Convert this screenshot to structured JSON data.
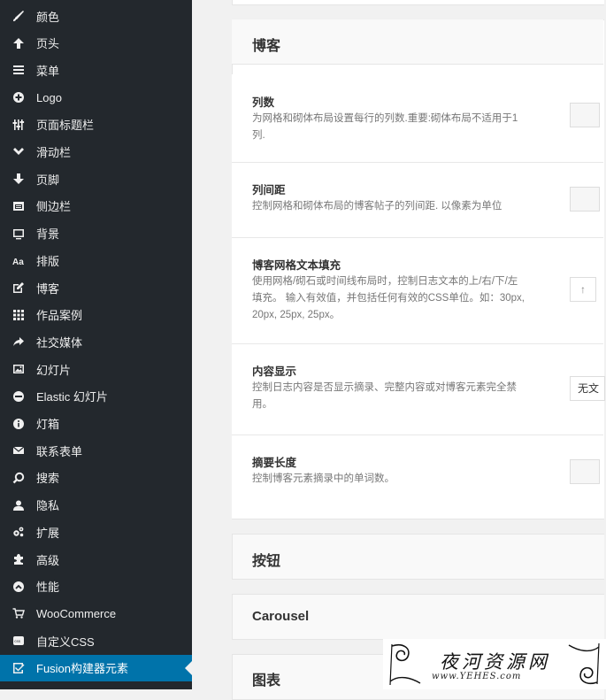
{
  "sidebar": {
    "items": [
      {
        "label": "颜色",
        "icon": "paintbrush-icon"
      },
      {
        "label": "页头",
        "icon": "arrow-up-icon"
      },
      {
        "label": "菜单",
        "icon": "menu-icon"
      },
      {
        "label": "Logo",
        "icon": "plus-circle-icon"
      },
      {
        "label": "页面标题栏",
        "icon": "sliders-icon"
      },
      {
        "label": "滑动栏",
        "icon": "chevron-down-icon"
      },
      {
        "label": "页脚",
        "icon": "arrow-down-icon"
      },
      {
        "label": "侧边栏",
        "icon": "sidebar-icon"
      },
      {
        "label": "背景",
        "icon": "monitor-icon"
      },
      {
        "label": "排版",
        "icon": "typography-icon"
      },
      {
        "label": "博客",
        "icon": "edit-icon"
      },
      {
        "label": "作品案例",
        "icon": "grid-icon"
      },
      {
        "label": "社交媒体",
        "icon": "share-icon"
      },
      {
        "label": "幻灯片",
        "icon": "image-icon"
      },
      {
        "label": "Elastic 幻灯片",
        "icon": "elastic-slider-icon"
      },
      {
        "label": "灯箱",
        "icon": "info-icon"
      },
      {
        "label": "联系表单",
        "icon": "envelope-icon"
      },
      {
        "label": "搜索",
        "icon": "search-icon"
      },
      {
        "label": "隐私",
        "icon": "user-icon"
      },
      {
        "label": "扩展",
        "icon": "gears-icon"
      },
      {
        "label": "高级",
        "icon": "puzzle-icon"
      },
      {
        "label": "性能",
        "icon": "dashboard-icon"
      },
      {
        "label": "WooCommerce",
        "icon": "cart-icon"
      },
      {
        "label": "自定义CSS",
        "icon": "css-icon"
      },
      {
        "label": "Fusion构建器元素",
        "icon": "checkbox-icon",
        "active": true
      },
      {
        "label": "",
        "icon": "partial-icon"
      }
    ]
  },
  "blog_section": {
    "title": "博客",
    "options": [
      {
        "title": "列数",
        "desc": "为网格和砌体布局设置每行的列数.重要:砌体布局不适用于1列.",
        "control": "input"
      },
      {
        "title": "列间距",
        "desc": "控制网格和砌体布局的博客帖子的列间距. 以像素为单位",
        "control": "input"
      },
      {
        "title": "博客网格文本填充",
        "desc": "使用网格/砌石或时间线布局时，控制日志文本的上/右/下/左填充。 输入有效值，并包括任何有效的CSS单位。如：30px, 20px, 25px, 25px。",
        "control": "button",
        "button_label": "↑"
      },
      {
        "title": "内容显示",
        "desc": "控制日志内容是否显示摘录、完整内容或对博客元素完全禁用。",
        "control": "select",
        "value": "无文"
      },
      {
        "title": "摘要长度",
        "desc": "控制博客元素摘录中的单词数。",
        "control": "input"
      }
    ]
  },
  "collapsed_sections": [
    {
      "title": "按钮"
    },
    {
      "title": "Carousel"
    },
    {
      "title": "图表"
    }
  ],
  "watermark": {
    "title": "夜河资源网",
    "subtitle": "www.YEHES.com"
  },
  "colors": {
    "sidebar_bg": "#23282d",
    "active_bg": "#0073aa",
    "content_bg": "#f1f1f1"
  }
}
